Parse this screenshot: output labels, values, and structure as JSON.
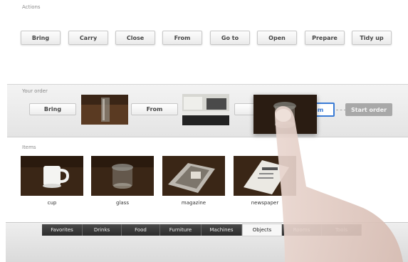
{
  "actions": {
    "label": "Actions",
    "buttons": [
      "Bring",
      "Carry",
      "Close",
      "From",
      "Go to",
      "Open",
      "Prepare",
      "Tidy up"
    ]
  },
  "order": {
    "label": "Your order",
    "step1": "Bring",
    "step2": "From",
    "slot_text": "Item",
    "start_label": "Start order"
  },
  "items": {
    "label": "Items",
    "list": [
      "cup",
      "glass",
      "magazine",
      "newspaper"
    ]
  },
  "tabs": [
    "Favorites",
    "Drinks",
    "Food",
    "Furniture",
    "Machines",
    "Objects",
    "Rooms",
    "Tools"
  ],
  "active_tab": "Objects",
  "colors": {
    "accent": "#3a7bd5",
    "tab_dark": "#2f2f2f",
    "start_disabled": "#a8a8a8"
  }
}
